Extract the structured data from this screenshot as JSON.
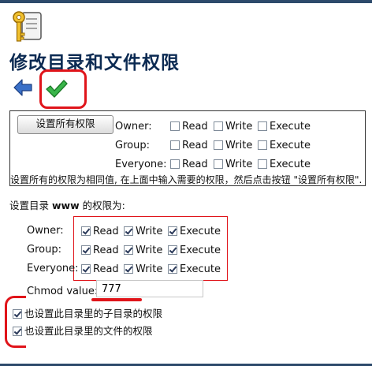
{
  "page": {
    "title": "修改目录和文件权限"
  },
  "toolbar": {
    "back_icon": "back-arrow-icon",
    "apply_icon": "checkmark-icon"
  },
  "set_all": {
    "button_label": "设置所有权限",
    "rows": [
      {
        "label": "Owner:"
      },
      {
        "label": "Group:"
      },
      {
        "label": "Everyone:"
      }
    ],
    "perm_labels": {
      "read": "Read",
      "write": "Write",
      "execute": "Execute"
    },
    "note": "设置所有的权限为相同值, 在上面中输入需要的权限，然后点击按钮 \"设置所有权限\"."
  },
  "directory": {
    "label_prefix": "设置目录",
    "name": "www",
    "label_suffix": "的权限为:",
    "rows": [
      {
        "label": "Owner:",
        "read": true,
        "write": true,
        "execute": true
      },
      {
        "label": "Group:",
        "read": true,
        "write": true,
        "execute": true
      },
      {
        "label": "Everyone:",
        "read": true,
        "write": true,
        "execute": true
      }
    ]
  },
  "chmod": {
    "label": "Chmod value:",
    "value": "777"
  },
  "options": {
    "subdirs": {
      "label": "也设置此目录里的子目录的权限",
      "checked": true
    },
    "files": {
      "label": "也设置此目录里的文件的权限",
      "checked": true
    }
  },
  "colors": {
    "highlight": "#e0141a",
    "title": "#0b2a52",
    "bar": "#2d4a6b"
  }
}
